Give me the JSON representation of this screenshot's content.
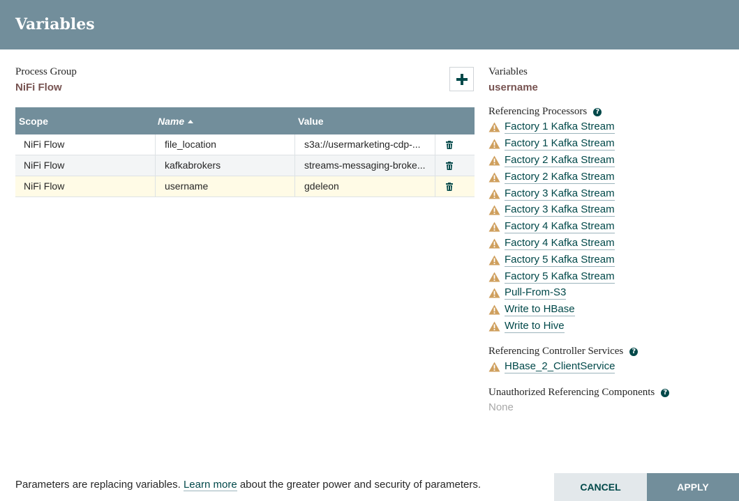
{
  "dialog": {
    "title": "Variables"
  },
  "process_group": {
    "label": "Process Group",
    "name": "NiFi Flow"
  },
  "table": {
    "columns": {
      "scope": "Scope",
      "name": "Name",
      "value": "Value"
    },
    "rows": [
      {
        "scope": "NiFi Flow",
        "name": "file_location",
        "value": "s3a://usermarketing-cdp-..."
      },
      {
        "scope": "NiFi Flow",
        "name": "kafkabrokers",
        "value": "streams-messaging-broke..."
      },
      {
        "scope": "NiFi Flow",
        "name": "username",
        "value": "gdeleon"
      }
    ]
  },
  "variables_panel": {
    "label": "Variables",
    "selected": "username",
    "referencing_processors_label": "Referencing Processors",
    "processors": [
      "Factory 1 Kafka Stream",
      "Factory 1 Kafka Stream",
      "Factory 2 Kafka Stream",
      "Factory 2 Kafka Stream",
      "Factory 3 Kafka Stream",
      "Factory 3 Kafka Stream",
      "Factory 4 Kafka Stream",
      "Factory 4 Kafka Stream",
      "Factory 5 Kafka Stream",
      "Factory 5 Kafka Stream",
      "Pull-From-S3",
      "Write to HBase",
      "Write to Hive"
    ],
    "controller_services_label": "Referencing Controller Services",
    "controller_services": [
      "HBase_2_ClientService"
    ],
    "unauthorized_label": "Unauthorized Referencing Components",
    "unauthorized_value": "None"
  },
  "footer": {
    "note_before": "Parameters are replacing variables. ",
    "note_link": "Learn more",
    "note_after": " about the greater power and security of parameters.",
    "cancel": "CANCEL",
    "apply": "APPLY"
  },
  "icons": {
    "add": "plus-icon",
    "delete": "trash-icon",
    "warning": "warning-icon",
    "help": "question-circle-icon",
    "sort": "sort-ascending-icon"
  },
  "colors": {
    "header": "#728e9b",
    "accent_text": "#775351",
    "link": "#004849",
    "warning": "#cf9f5d",
    "selected_row": "#fffbe6"
  }
}
